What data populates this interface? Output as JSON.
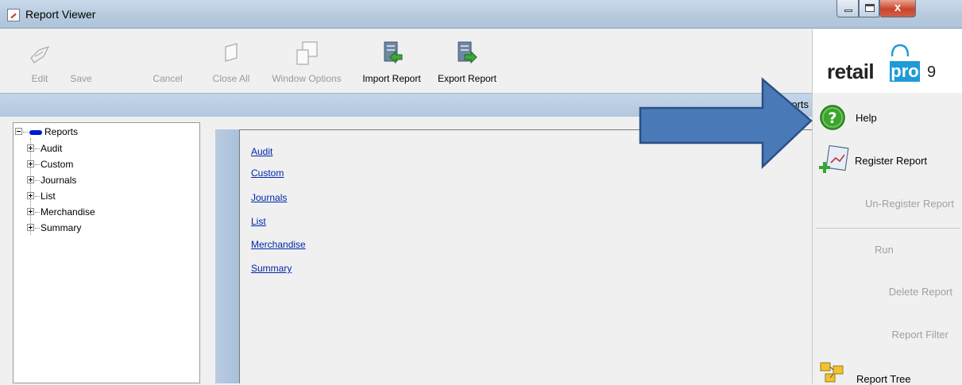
{
  "window": {
    "title": "Report Viewer",
    "close_glyph": "x"
  },
  "toolbar": {
    "buttons": [
      {
        "label": "Edit",
        "icon": "edit-icon",
        "enabled": false
      },
      {
        "label": "Save",
        "icon": "save-icon",
        "enabled": false
      },
      {
        "label": "Cancel",
        "icon": "cancel-icon",
        "enabled": false
      },
      {
        "label": "Close All",
        "icon": "close-all-icon",
        "enabled": false
      },
      {
        "label": "Window Options",
        "icon": "window-options-icon",
        "enabled": false
      },
      {
        "label": "Import Report",
        "icon": "import-report-icon",
        "enabled": true
      },
      {
        "label": "Export Report",
        "icon": "export-report-icon",
        "enabled": true
      }
    ]
  },
  "logo": {
    "text_left": "retail",
    "text_box": "pro",
    "version": "9",
    "brand_color": "#1e9bd8"
  },
  "strip": {
    "label": "orts"
  },
  "tree": {
    "root": "Reports",
    "children": [
      "Audit",
      "Custom",
      "Journals",
      "List",
      "Merchandise",
      "Summary"
    ]
  },
  "content": {
    "links": [
      "Audit",
      "Custom",
      "Journals",
      "List",
      "Merchandise",
      "Summary"
    ]
  },
  "actions": {
    "help": "Help",
    "register": "Register Report",
    "unregister": "Un-Register Report",
    "run": "Run",
    "delete": "Delete Report",
    "filter": "Report Filter",
    "report_tree": "Report Tree"
  },
  "colors": {
    "arrow_fill": "#4a79b8",
    "arrow_stroke": "#2b4f86",
    "link": "#0026a8",
    "help_green": "#3da52e"
  }
}
